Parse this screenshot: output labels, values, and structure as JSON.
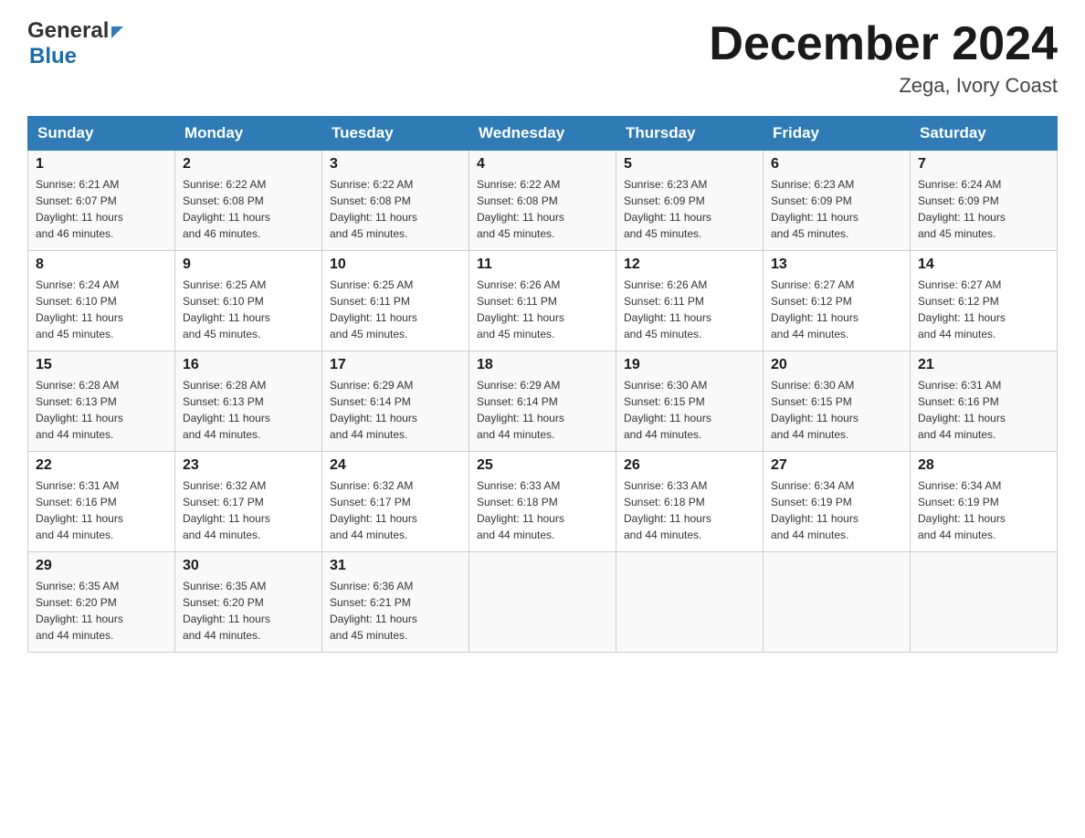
{
  "header": {
    "logo_general": "General",
    "logo_blue": "Blue",
    "month_title": "December 2024",
    "location": "Zega, Ivory Coast"
  },
  "days_of_week": [
    "Sunday",
    "Monday",
    "Tuesday",
    "Wednesday",
    "Thursday",
    "Friday",
    "Saturday"
  ],
  "weeks": [
    [
      {
        "num": "1",
        "sunrise": "6:21 AM",
        "sunset": "6:07 PM",
        "daylight": "11 hours and 46 minutes."
      },
      {
        "num": "2",
        "sunrise": "6:22 AM",
        "sunset": "6:08 PM",
        "daylight": "11 hours and 46 minutes."
      },
      {
        "num": "3",
        "sunrise": "6:22 AM",
        "sunset": "6:08 PM",
        "daylight": "11 hours and 45 minutes."
      },
      {
        "num": "4",
        "sunrise": "6:22 AM",
        "sunset": "6:08 PM",
        "daylight": "11 hours and 45 minutes."
      },
      {
        "num": "5",
        "sunrise": "6:23 AM",
        "sunset": "6:09 PM",
        "daylight": "11 hours and 45 minutes."
      },
      {
        "num": "6",
        "sunrise": "6:23 AM",
        "sunset": "6:09 PM",
        "daylight": "11 hours and 45 minutes."
      },
      {
        "num": "7",
        "sunrise": "6:24 AM",
        "sunset": "6:09 PM",
        "daylight": "11 hours and 45 minutes."
      }
    ],
    [
      {
        "num": "8",
        "sunrise": "6:24 AM",
        "sunset": "6:10 PM",
        "daylight": "11 hours and 45 minutes."
      },
      {
        "num": "9",
        "sunrise": "6:25 AM",
        "sunset": "6:10 PM",
        "daylight": "11 hours and 45 minutes."
      },
      {
        "num": "10",
        "sunrise": "6:25 AM",
        "sunset": "6:11 PM",
        "daylight": "11 hours and 45 minutes."
      },
      {
        "num": "11",
        "sunrise": "6:26 AM",
        "sunset": "6:11 PM",
        "daylight": "11 hours and 45 minutes."
      },
      {
        "num": "12",
        "sunrise": "6:26 AM",
        "sunset": "6:11 PM",
        "daylight": "11 hours and 45 minutes."
      },
      {
        "num": "13",
        "sunrise": "6:27 AM",
        "sunset": "6:12 PM",
        "daylight": "11 hours and 44 minutes."
      },
      {
        "num": "14",
        "sunrise": "6:27 AM",
        "sunset": "6:12 PM",
        "daylight": "11 hours and 44 minutes."
      }
    ],
    [
      {
        "num": "15",
        "sunrise": "6:28 AM",
        "sunset": "6:13 PM",
        "daylight": "11 hours and 44 minutes."
      },
      {
        "num": "16",
        "sunrise": "6:28 AM",
        "sunset": "6:13 PM",
        "daylight": "11 hours and 44 minutes."
      },
      {
        "num": "17",
        "sunrise": "6:29 AM",
        "sunset": "6:14 PM",
        "daylight": "11 hours and 44 minutes."
      },
      {
        "num": "18",
        "sunrise": "6:29 AM",
        "sunset": "6:14 PM",
        "daylight": "11 hours and 44 minutes."
      },
      {
        "num": "19",
        "sunrise": "6:30 AM",
        "sunset": "6:15 PM",
        "daylight": "11 hours and 44 minutes."
      },
      {
        "num": "20",
        "sunrise": "6:30 AM",
        "sunset": "6:15 PM",
        "daylight": "11 hours and 44 minutes."
      },
      {
        "num": "21",
        "sunrise": "6:31 AM",
        "sunset": "6:16 PM",
        "daylight": "11 hours and 44 minutes."
      }
    ],
    [
      {
        "num": "22",
        "sunrise": "6:31 AM",
        "sunset": "6:16 PM",
        "daylight": "11 hours and 44 minutes."
      },
      {
        "num": "23",
        "sunrise": "6:32 AM",
        "sunset": "6:17 PM",
        "daylight": "11 hours and 44 minutes."
      },
      {
        "num": "24",
        "sunrise": "6:32 AM",
        "sunset": "6:17 PM",
        "daylight": "11 hours and 44 minutes."
      },
      {
        "num": "25",
        "sunrise": "6:33 AM",
        "sunset": "6:18 PM",
        "daylight": "11 hours and 44 minutes."
      },
      {
        "num": "26",
        "sunrise": "6:33 AM",
        "sunset": "6:18 PM",
        "daylight": "11 hours and 44 minutes."
      },
      {
        "num": "27",
        "sunrise": "6:34 AM",
        "sunset": "6:19 PM",
        "daylight": "11 hours and 44 minutes."
      },
      {
        "num": "28",
        "sunrise": "6:34 AM",
        "sunset": "6:19 PM",
        "daylight": "11 hours and 44 minutes."
      }
    ],
    [
      {
        "num": "29",
        "sunrise": "6:35 AM",
        "sunset": "6:20 PM",
        "daylight": "11 hours and 44 minutes."
      },
      {
        "num": "30",
        "sunrise": "6:35 AM",
        "sunset": "6:20 PM",
        "daylight": "11 hours and 44 minutes."
      },
      {
        "num": "31",
        "sunrise": "6:36 AM",
        "sunset": "6:21 PM",
        "daylight": "11 hours and 45 minutes."
      },
      null,
      null,
      null,
      null
    ]
  ],
  "labels": {
    "sunrise": "Sunrise:",
    "sunset": "Sunset:",
    "daylight": "Daylight:"
  }
}
